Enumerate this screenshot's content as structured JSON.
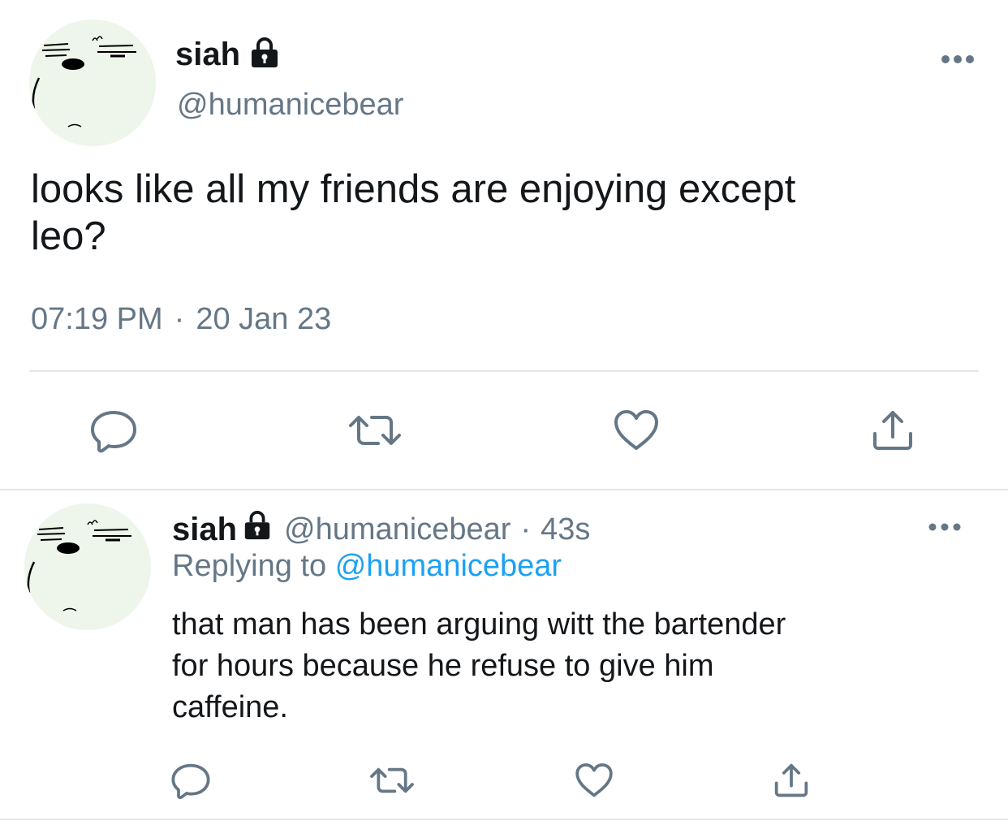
{
  "main_tweet": {
    "display_name": "siah",
    "handle": "@humanicebear",
    "text": "looks like all my friends are enjoying except\nleo?",
    "time": "07:19 PM",
    "separator": "·",
    "date": "20 Jan 23",
    "avatar_icon": "grumpy-face-avatar",
    "lock_icon": "lock-icon",
    "more_icon": "more-icon"
  },
  "reply_tweet": {
    "display_name": "siah",
    "handle": "@humanicebear",
    "separator": "·",
    "age": "43s",
    "replying_prefix": "Replying to",
    "replying_to": "@humanicebear",
    "text": "that man has been arguing witt the bartender\nfor hours because he refuse to give him\ncaffeine.",
    "avatar_icon": "grumpy-face-avatar",
    "lock_icon": "lock-icon",
    "more_icon": "more-icon"
  },
  "actions": [
    "reply-icon",
    "retweet-icon",
    "like-icon",
    "share-icon"
  ],
  "colors": {
    "text": "#14171a",
    "secondary": "#657786",
    "link": "#1da1f2",
    "divider": "#e1e8ed",
    "avatar_bg": "#eef5ea"
  }
}
